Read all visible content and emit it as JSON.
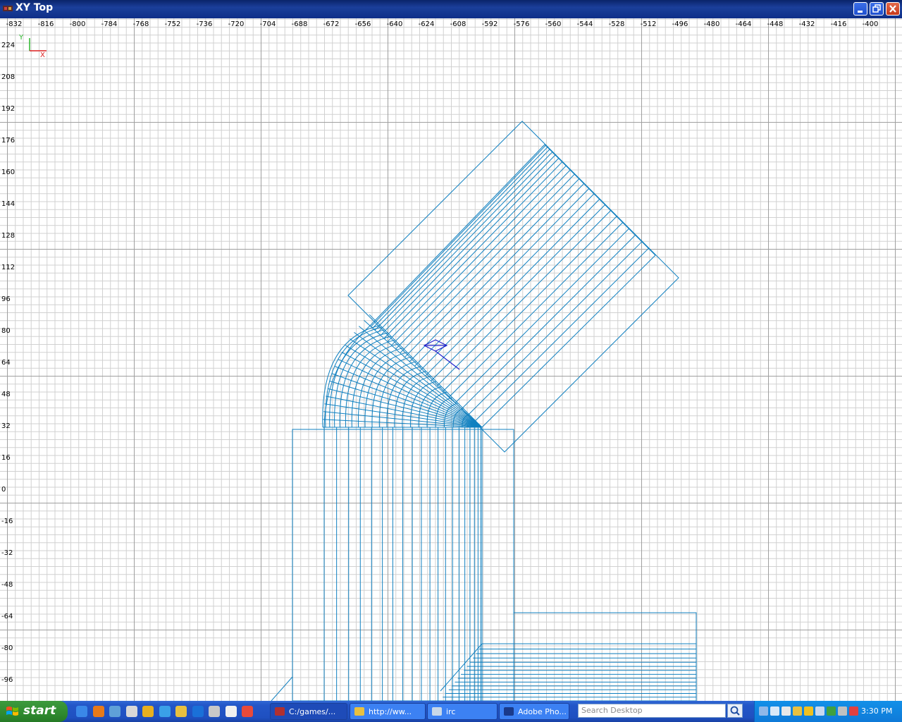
{
  "window": {
    "title": "XY Top",
    "controls": [
      "minimize",
      "maximize",
      "close"
    ]
  },
  "ruler_x": [
    "-832",
    "-816",
    "-800",
    "-784",
    "-768",
    "-752",
    "-736",
    "-720",
    "-704",
    "-688",
    "-672",
    "-656",
    "-640",
    "-624",
    "-608",
    "-592",
    "-576",
    "-560",
    "-544",
    "-528",
    "-512",
    "-496",
    "-480",
    "-464",
    "-448",
    "-432",
    "-416",
    "-400"
  ],
  "ruler_y": [
    "224",
    "208",
    "192",
    "176",
    "160",
    "144",
    "128",
    "112",
    "96",
    "80",
    "64",
    "48",
    "32",
    "16",
    "0",
    "-16",
    "-32",
    "-48",
    "-64",
    "-80",
    "-96"
  ],
  "axis": {
    "y_label": "Y",
    "x_label": "X",
    "y_color": "#2bb52b",
    "x_color": "#dd2222"
  },
  "colors": {
    "brush": "#1080c0",
    "grid_major": "#9f9f9f",
    "grid_minor": "#d0d0d0",
    "camera": "#2020cc"
  },
  "taskbar": {
    "start_label": "start",
    "quick_launch": [
      "ie-icon",
      "firefox-icon",
      "messenger-icon",
      "network-icon",
      "winamp-icon",
      "app-icon",
      "explorer-icon",
      "ie-alt-icon",
      "trillian-icon",
      "document-icon",
      "chrome-icon"
    ],
    "tasks": [
      {
        "label": "C:/games/...",
        "icon": "radiant-icon",
        "active": true
      },
      {
        "label": "http://ww...",
        "icon": "chrome-icon",
        "active": false
      },
      {
        "label": "irc",
        "icon": "irc-icon",
        "active": false
      },
      {
        "label": "Adobe Pho...",
        "icon": "photoshop-icon",
        "active": false
      }
    ],
    "search_placeholder": "Search Desktop",
    "clock": "3:30 PM"
  }
}
